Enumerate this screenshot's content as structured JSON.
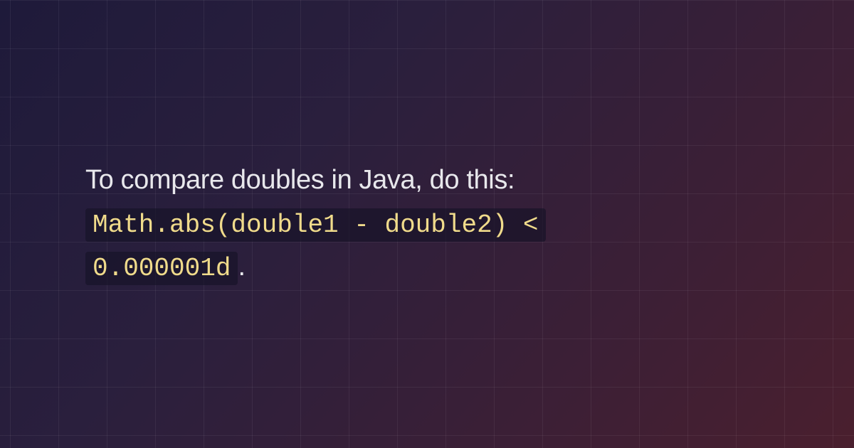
{
  "content": {
    "intro_text": "To compare doubles in Java, do this:",
    "code_line1": "Math.abs(double1 - double2) <",
    "code_line2": "0.000001d",
    "period": "."
  }
}
